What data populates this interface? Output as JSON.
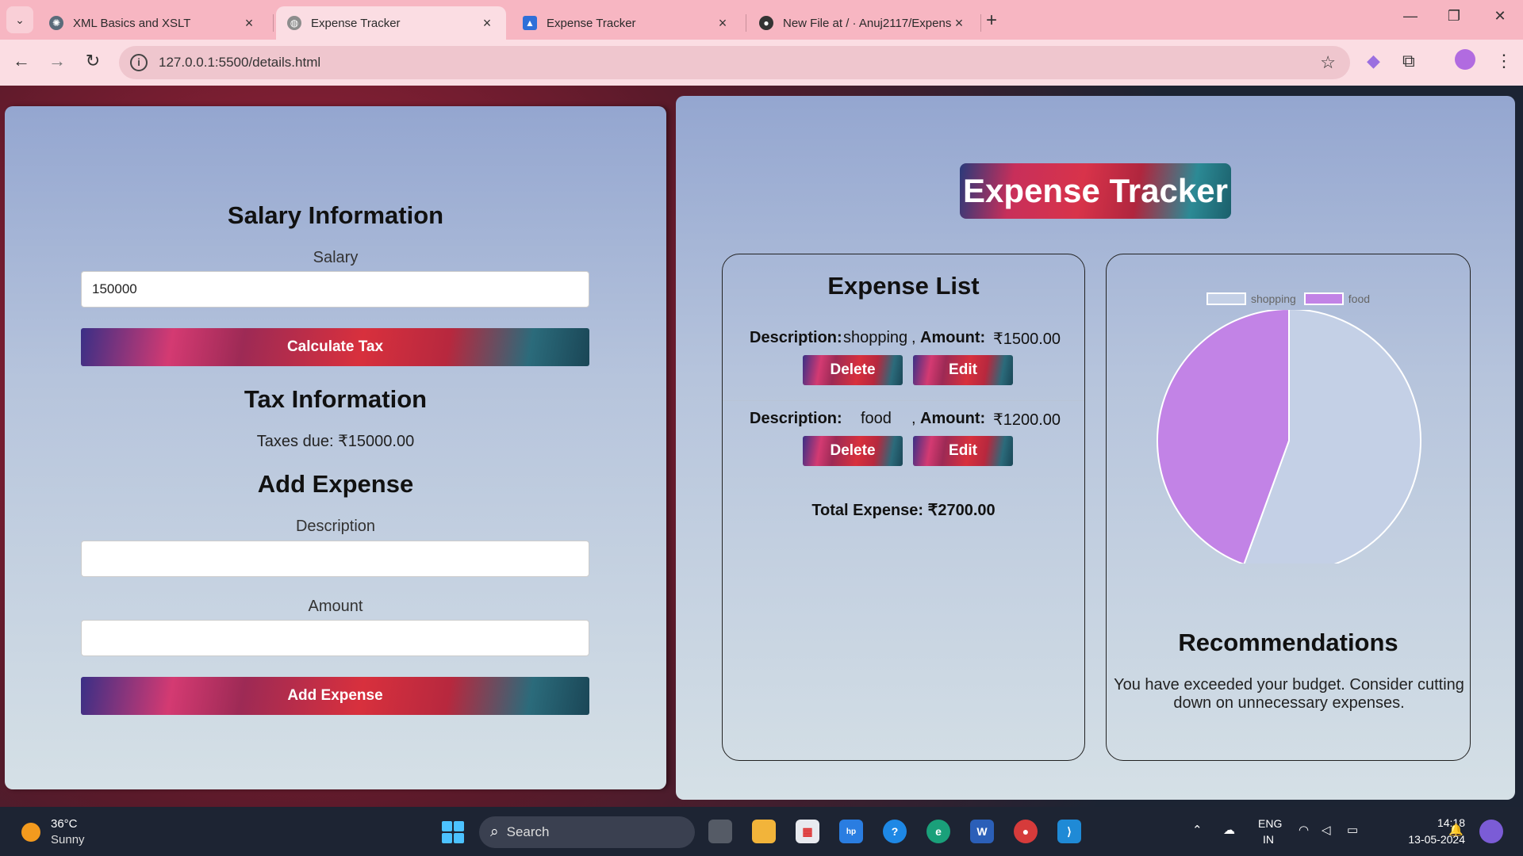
{
  "browser": {
    "tabs": [
      {
        "title": "XML Basics and XSLT",
        "active": false
      },
      {
        "title": "Expense Tracker",
        "active": true
      },
      {
        "title": "Expense Tracker",
        "active": false
      },
      {
        "title": "New File at / · Anuj2117/Expens",
        "active": false
      }
    ],
    "url": "127.0.0.1:5500/details.html"
  },
  "left": {
    "salary_heading": "Salary Information",
    "salary_label": "Salary",
    "salary_value": "150000",
    "calc_button": "Calculate Tax",
    "tax_heading": "Tax Information",
    "taxes_due": "Taxes due: ₹15000.00",
    "add_heading": "Add Expense",
    "desc_label": "Description",
    "desc_value": "",
    "amount_label": "Amount",
    "amount_value": "",
    "add_button": "Add Expense"
  },
  "right": {
    "app_title": "Expense Tracker",
    "list_heading": "Expense List",
    "desc_label": "Description:",
    "amount_label": "Amount:",
    "comma": ",",
    "expenses": [
      {
        "description": "shopping",
        "amount": "₹1500.00",
        "delete": "Delete",
        "edit": "Edit"
      },
      {
        "description": "food",
        "amount": "₹1200.00",
        "delete": "Delete",
        "edit": "Edit"
      }
    ],
    "total": "Total Expense: ₹2700.00",
    "rec_heading": "Recommendations",
    "rec_text": "You have exceeded your budget. Consider cutting down on unnecessary expenses."
  },
  "chart_data": {
    "type": "pie",
    "categories": [
      "shopping",
      "food"
    ],
    "values": [
      1500,
      1200
    ],
    "colors": [
      "#c4d0e6",
      "#c283e6"
    ],
    "legend_position": "top"
  },
  "taskbar": {
    "temperature": "36°C",
    "condition": "Sunny",
    "search_text": "Search",
    "lang1": "ENG",
    "lang2": "IN",
    "time": "14:18",
    "date": "13-05-2024"
  }
}
